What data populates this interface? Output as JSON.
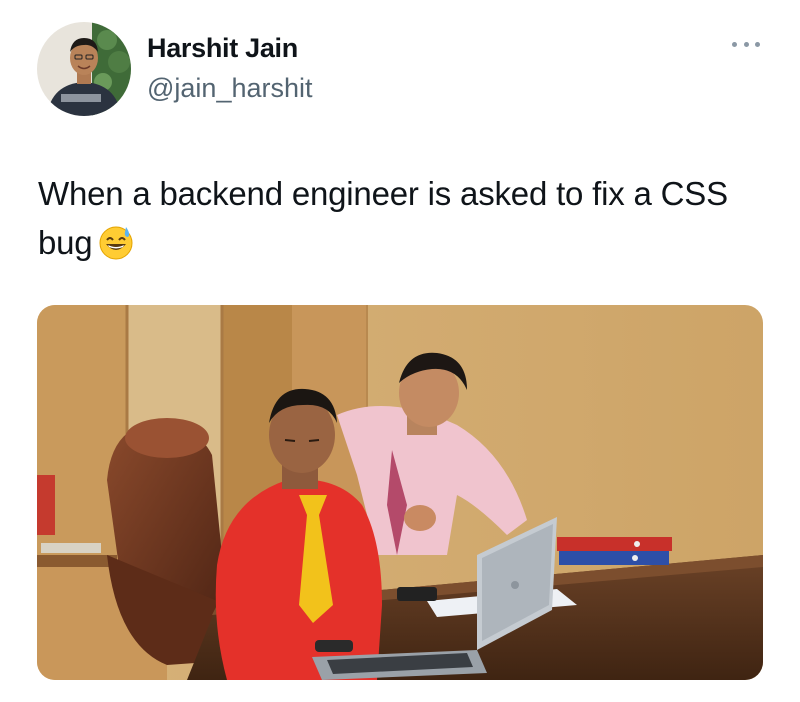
{
  "tweet": {
    "author": {
      "name": "Harshit Jain",
      "handle": "@jain_harshit",
      "avatar_icon": "profile-photo"
    },
    "more_icon": "more-dots-icon",
    "text": "When a backend engineer is asked to fix a CSS bug",
    "emoji": "grinning-face-with-sweat",
    "media": {
      "kind": "photo",
      "description_icon": "meme-photo"
    }
  },
  "colors": {
    "text": "#0f1419",
    "secondary": "#536471",
    "shirt_red": "#e8322b",
    "tie_yellow": "#f2c21b",
    "shirt_pink": "#f1c6cf",
    "wood": "#c79a5b",
    "chair": "#7a3b24",
    "laptop": "#b9bec4"
  }
}
